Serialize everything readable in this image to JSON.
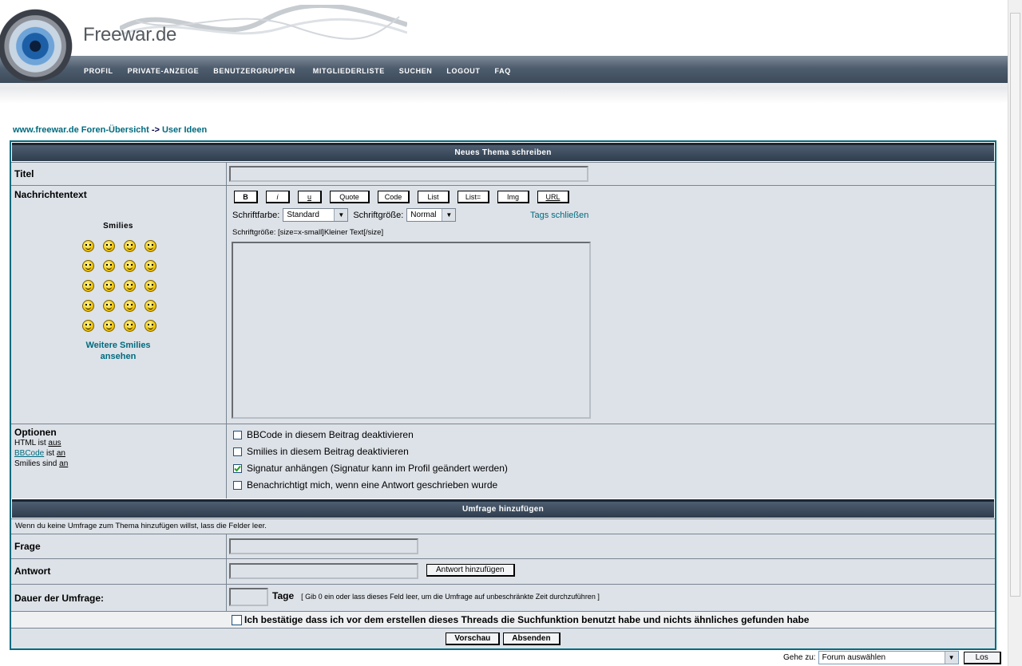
{
  "header": {
    "logo": "Freewar.de",
    "nav": [
      "PROFIL",
      "PRIVATE-ANZEIGE",
      "BENUTZERGRUPPEN",
      "MITGLIEDERLISTE",
      "SUCHEN",
      "LOGOUT",
      "FAQ"
    ]
  },
  "breadcrumb": {
    "home": "www.freewar.de Foren-Übersicht",
    "separator": "->",
    "forum": "User Ideen"
  },
  "post": {
    "heading": "Neues Thema schreiben",
    "title_label": "Titel",
    "title_value": "",
    "message_label": "Nachrichtentext",
    "smilies_label": "Smilies",
    "more_smilies": "Weitere Smilies ansehen",
    "bbcode_buttons": [
      "B",
      "i",
      "u",
      "Quote",
      "Code",
      "List",
      "List=",
      "Img",
      "URL"
    ],
    "font_color_label": "Schriftfarbe:",
    "font_color_value": "Standard",
    "font_size_label": "Schriftgröße:",
    "font_size_value": "Normal",
    "close_tags": "Tags schließen",
    "helpline": "Schriftgröße: [size=x-small]Kleiner Text[/size]",
    "message_value": ""
  },
  "options": {
    "label": "Optionen",
    "html_status": "HTML ist",
    "html_value": "aus",
    "bbcode_link": "BBCode",
    "bbcode_status": "ist",
    "bbcode_value": "an",
    "smilies_status": "Smilies sind",
    "smilies_value": "an",
    "checkboxes": [
      {
        "label": "BBCode in diesem Beitrag deaktivieren",
        "checked": false
      },
      {
        "label": "Smilies in diesem Beitrag deaktivieren",
        "checked": false
      },
      {
        "label": "Signatur anhängen (Signatur kann im Profil geändert werden)",
        "checked": true
      },
      {
        "label": "Benachrichtigt mich, wenn eine Antwort geschrieben wurde",
        "checked": false
      }
    ]
  },
  "poll": {
    "heading": "Umfrage hinzufügen",
    "info": "Wenn du keine Umfrage zum Thema hinzufügen willst, lass die Felder leer.",
    "question_label": "Frage",
    "question_value": "",
    "answer_label": "Antwort",
    "answer_value": "",
    "add_answer": "Antwort hinzufügen",
    "duration_label": "Dauer der Umfrage:",
    "duration_value": "",
    "duration_unit": "Tage",
    "duration_hint": "[ Gib 0 ein oder lass dieses Feld leer, um die Umfrage auf unbeschränkte Zeit durchzuführen ]"
  },
  "confirm": {
    "label": "Ich bestätige dass ich vor dem erstellen dieses Threads die Suchfunktion benutzt habe und nichts ähnliches gefunden habe",
    "checked": false
  },
  "actions": {
    "preview": "Vorschau",
    "submit": "Absenden"
  },
  "jump": {
    "label": "Gehe zu:",
    "value": "Forum auswählen",
    "go": "Los"
  }
}
